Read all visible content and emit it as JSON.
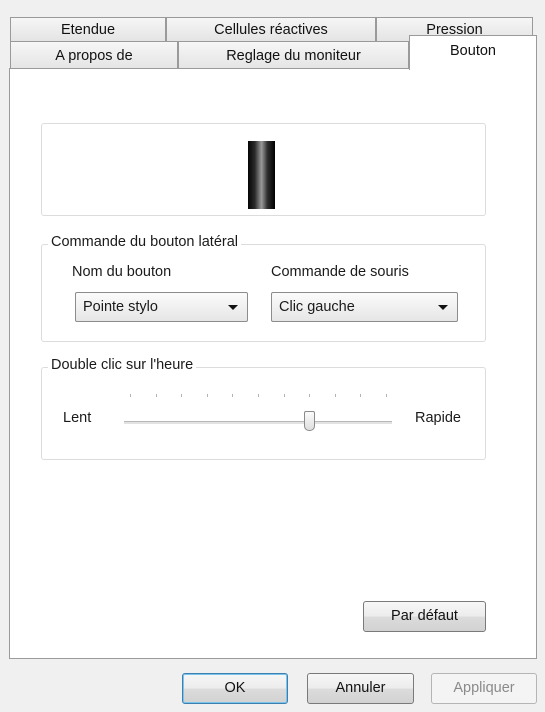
{
  "tabs_back": [
    {
      "label": "Etendue"
    },
    {
      "label": "Cellules réactives"
    },
    {
      "label": "Pression"
    }
  ],
  "tabs_front": [
    {
      "label": "A propos de"
    },
    {
      "label": "Reglage du moniteur"
    },
    {
      "label": "Bouton",
      "active": true
    }
  ],
  "side_button_group": {
    "title": "Commande du bouton latéral",
    "button_name_label": "Nom du bouton",
    "button_name_value": "Pointe stylo",
    "mouse_command_label": "Commande de souris",
    "mouse_command_value": "Clic gauche"
  },
  "double_click_group": {
    "title": "Double clic sur l'heure",
    "slow_label": "Lent",
    "fast_label": "Rapide",
    "speed_fraction": 0.7
  },
  "default_button_label": "Par défaut",
  "dialog_buttons": {
    "ok": "OK",
    "cancel": "Annuler",
    "apply": "Appliquer"
  },
  "colors": {
    "panel_bg": "#ffffff",
    "dialog_bg": "#f0f0f0",
    "default_button_border": "#3c7fb1"
  }
}
